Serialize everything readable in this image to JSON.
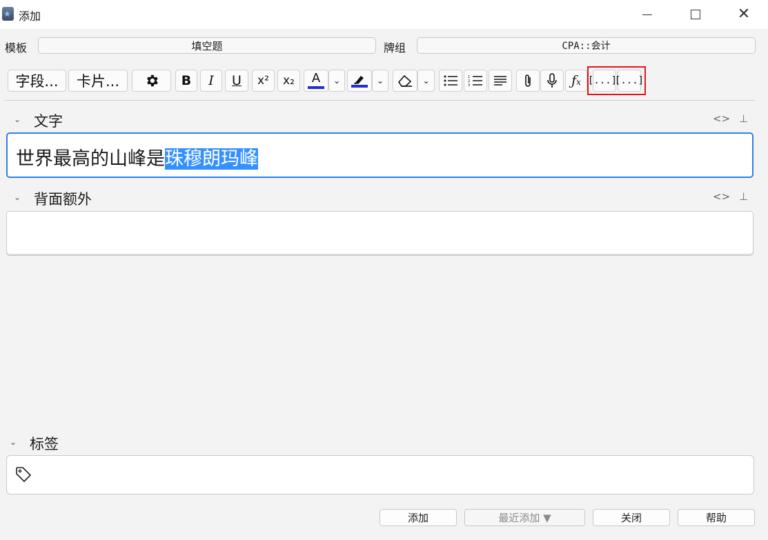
{
  "window": {
    "title": "添加",
    "app_icon": "anki-star-icon"
  },
  "note_row": {
    "type_label": "模板",
    "type_value": "填空题",
    "deck_label": "牌组",
    "deck_value": "CPA::会计"
  },
  "toolbar": {
    "fields_label": "字段...",
    "cards_label": "卡片...",
    "bold": "B",
    "italic": "I",
    "underline": "U",
    "superscript": "x²",
    "subscript": "x₂",
    "text_color_letter": "A",
    "text_color": "#1f2fd1",
    "highlight_color": "#1f2fd1",
    "cloze_label": "[...]"
  },
  "fields": [
    {
      "name": "文字",
      "content_plain": "世界最高的山峰是",
      "content_selected": "珠穆朗玛峰"
    },
    {
      "name": "背面额外",
      "content_plain": ""
    }
  ],
  "tags": {
    "label": "标签"
  },
  "buttons": {
    "add": "添加",
    "history": "最近添加 ▼",
    "close": "关闭",
    "help": "帮助"
  },
  "colors": {
    "selection": "#3390ff",
    "focus_border": "#2f7fe0",
    "highlight_box": "#e0141c"
  }
}
